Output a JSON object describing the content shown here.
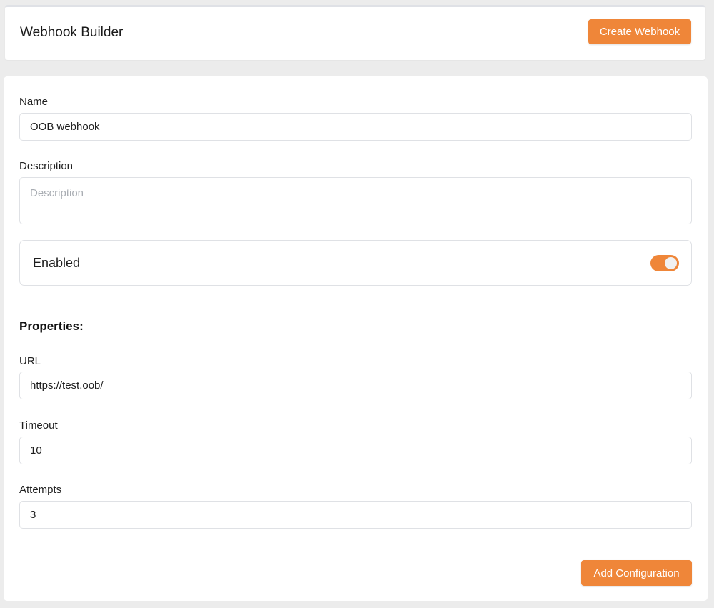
{
  "header": {
    "title": "Webhook Builder",
    "create_button": "Create Webhook"
  },
  "form": {
    "name": {
      "label": "Name",
      "value": "OOB webhook"
    },
    "description": {
      "label": "Description",
      "value": "",
      "placeholder": "Description"
    },
    "enabled": {
      "label": "Enabled",
      "state": true
    },
    "properties_heading": "Properties:",
    "url": {
      "label": "URL",
      "value": "https://test.oob/"
    },
    "timeout": {
      "label": "Timeout",
      "value": "10"
    },
    "attempts": {
      "label": "Attempts",
      "value": "3"
    },
    "add_button": "Add Configuration"
  },
  "colors": {
    "accent": "#ef8639",
    "background": "#ececec",
    "card": "#ffffff",
    "border": "#dfe1e5"
  }
}
